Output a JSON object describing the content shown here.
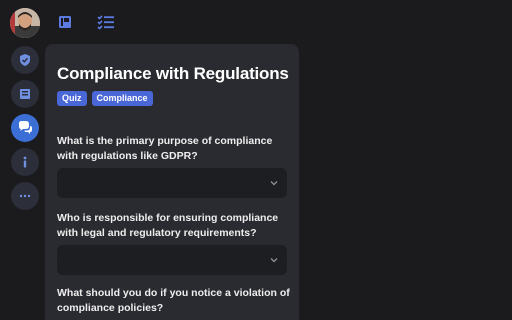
{
  "colors": {
    "background": "#1b1b1e",
    "card": "#2a2b30",
    "accent": "#3b6fd6",
    "tag": "#4a67d8",
    "select_bg": "#1d1e22"
  },
  "sidebar": {
    "items": [
      {
        "icon": "shield-check-icon",
        "active": false
      },
      {
        "icon": "book-icon",
        "active": false
      },
      {
        "icon": "chat-bubbles-icon",
        "active": true
      },
      {
        "icon": "info-icon",
        "active": false
      },
      {
        "icon": "more-dots-icon",
        "active": false
      }
    ]
  },
  "top_tabs": [
    {
      "icon": "notebook-icon"
    },
    {
      "icon": "checklist-icon"
    }
  ],
  "quiz": {
    "title": "Compliance with Regulations",
    "tags": [
      "Quiz",
      "Compliance"
    ],
    "questions": [
      {
        "text": "What is the primary purpose of compliance with regulations like GDPR?",
        "selected": ""
      },
      {
        "text": "Who is responsible for ensuring compliance with legal and regulatory requirements?",
        "selected": ""
      },
      {
        "text": "What should you do if you notice a violation of compliance policies?",
        "selected": ""
      }
    ]
  }
}
